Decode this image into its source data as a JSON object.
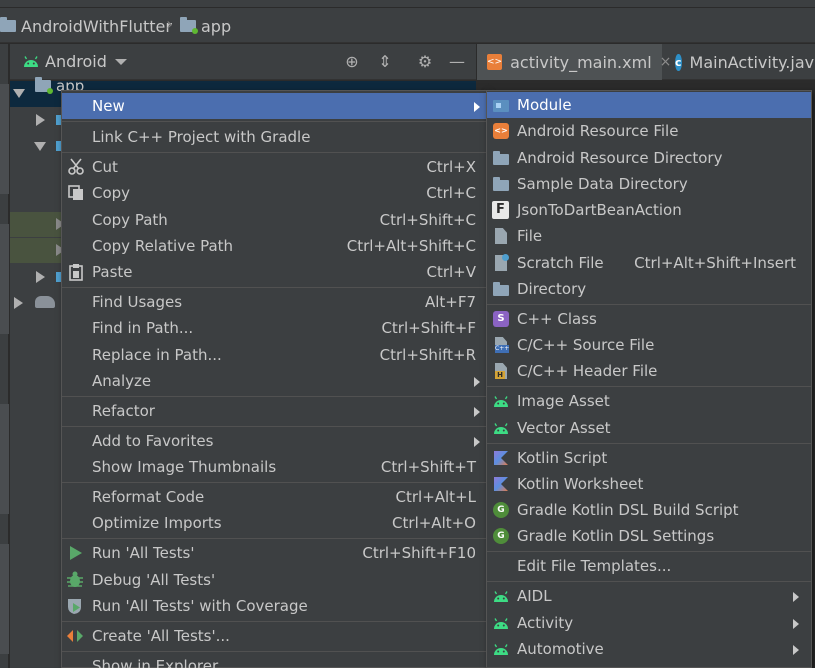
{
  "breadcrumb": {
    "project": "AndroidWithFlutter",
    "module": "app"
  },
  "project_panel": {
    "view_label": "Android"
  },
  "tree": {
    "root_label": "app"
  },
  "editor_tabs": [
    {
      "label": "activity_main.xml",
      "close": "×"
    },
    {
      "label": "MainActivity.java"
    }
  ],
  "context_menu": {
    "items": [
      {
        "label": "New",
        "shortcut": "",
        "submenu": true,
        "highlighted": true
      },
      {
        "label": "Link C++ Project with Gradle",
        "shortcut": ""
      },
      {
        "label": "Cut",
        "shortcut": "Ctrl+X",
        "icon": "scissors-icon"
      },
      {
        "label": "Copy",
        "shortcut": "Ctrl+C",
        "icon": "copy-icon"
      },
      {
        "label": "Copy Path",
        "shortcut": "Ctrl+Shift+C"
      },
      {
        "label": "Copy Relative Path",
        "shortcut": "Ctrl+Alt+Shift+C"
      },
      {
        "label": "Paste",
        "shortcut": "Ctrl+V",
        "icon": "clipboard-icon"
      },
      {
        "label": "Find Usages",
        "shortcut": "Alt+F7"
      },
      {
        "label": "Find in Path...",
        "shortcut": "Ctrl+Shift+F"
      },
      {
        "label": "Replace in Path...",
        "shortcut": "Ctrl+Shift+R"
      },
      {
        "label": "Analyze",
        "shortcut": "",
        "submenu": true
      },
      {
        "label": "Refactor",
        "shortcut": "",
        "submenu": true
      },
      {
        "label": "Add to Favorites",
        "shortcut": "",
        "submenu": true
      },
      {
        "label": "Show Image Thumbnails",
        "shortcut": "Ctrl+Shift+T"
      },
      {
        "label": "Reformat Code",
        "shortcut": "Ctrl+Alt+L"
      },
      {
        "label": "Optimize Imports",
        "shortcut": "Ctrl+Alt+O"
      },
      {
        "label": "Run 'All Tests'",
        "shortcut": "Ctrl+Shift+F10",
        "icon": "run-icon"
      },
      {
        "label": "Debug 'All Tests'",
        "shortcut": "",
        "icon": "debug-icon"
      },
      {
        "label": "Run 'All Tests' with Coverage",
        "shortcut": "",
        "icon": "coverage-icon"
      },
      {
        "label": "Create 'All Tests'...",
        "shortcut": "",
        "icon": "create-test-icon"
      },
      {
        "label": "Show in Explorer",
        "shortcut": ""
      }
    ]
  },
  "new_submenu": {
    "items": [
      {
        "label": "Module",
        "shortcut": "",
        "icon": "module-icon",
        "highlighted": true
      },
      {
        "label": "Android Resource File",
        "shortcut": "",
        "icon": "android-resource-file-icon"
      },
      {
        "label": "Android Resource Directory",
        "shortcut": "",
        "icon": "folder-icon"
      },
      {
        "label": "Sample Data Directory",
        "shortcut": "",
        "icon": "folder-icon"
      },
      {
        "label": "JsonToDartBeanAction",
        "shortcut": "",
        "icon": "f-icon"
      },
      {
        "label": "File",
        "shortcut": "",
        "icon": "file-icon"
      },
      {
        "label": "Scratch File",
        "shortcut": "Ctrl+Alt+Shift+Insert",
        "icon": "scratch-file-icon"
      },
      {
        "label": "Directory",
        "shortcut": "",
        "icon": "folder-icon"
      },
      {
        "label": "C++ Class",
        "shortcut": "",
        "icon": "cpp-class-icon"
      },
      {
        "label": "C/C++ Source File",
        "shortcut": "",
        "icon": "cpp-source-icon"
      },
      {
        "label": "C/C++ Header File",
        "shortcut": "",
        "icon": "cpp-header-icon"
      },
      {
        "label": "Image Asset",
        "shortcut": "",
        "icon": "android-icon"
      },
      {
        "label": "Vector Asset",
        "shortcut": "",
        "icon": "android-icon"
      },
      {
        "label": "Kotlin Script",
        "shortcut": "",
        "icon": "kotlin-icon"
      },
      {
        "label": "Kotlin Worksheet",
        "shortcut": "",
        "icon": "kotlin-icon"
      },
      {
        "label": "Gradle Kotlin DSL Build Script",
        "shortcut": "",
        "icon": "gradle-icon"
      },
      {
        "label": "Gradle Kotlin DSL Settings",
        "shortcut": "",
        "icon": "gradle-icon"
      },
      {
        "label": "Edit File Templates...",
        "shortcut": ""
      },
      {
        "label": "AIDL",
        "shortcut": "",
        "icon": "android-icon",
        "submenu": true
      },
      {
        "label": "Activity",
        "shortcut": "",
        "icon": "android-icon",
        "submenu": true
      },
      {
        "label": "Automotive",
        "shortcut": "",
        "icon": "android-icon",
        "submenu": true
      }
    ]
  },
  "colors": {
    "highlight": "#4b6eaf",
    "menu_bg": "#3c3f41",
    "android_green": "#3ddc84",
    "editor_bg": "#2b2b2b"
  }
}
